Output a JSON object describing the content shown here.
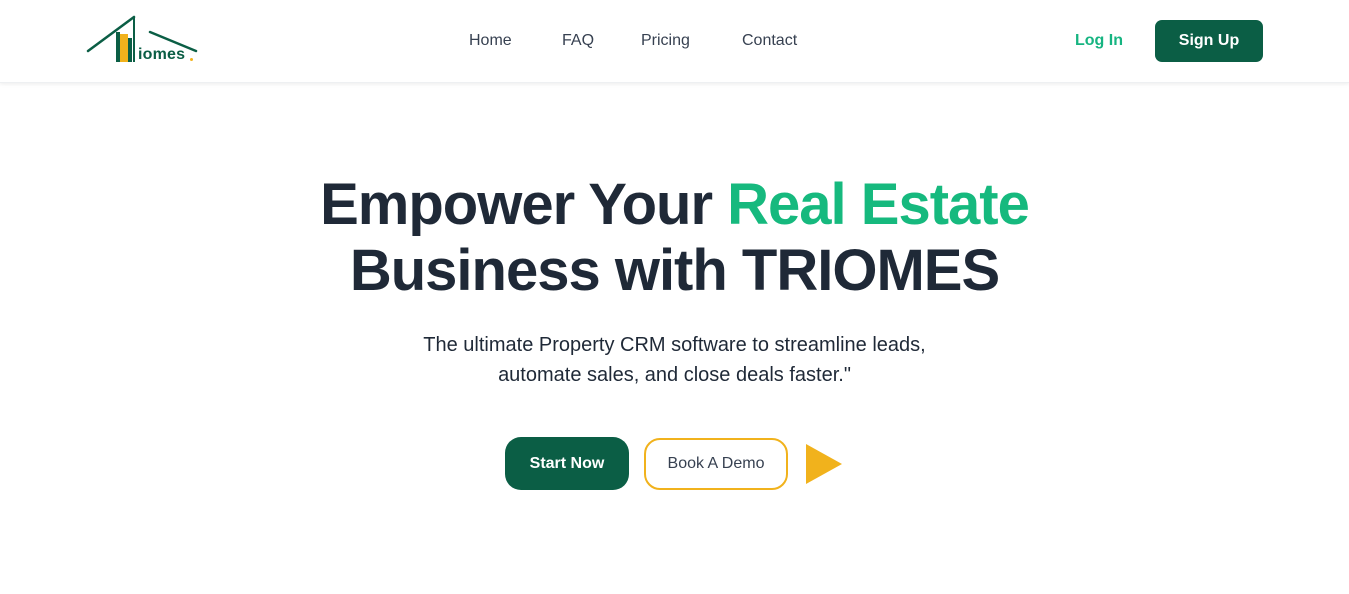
{
  "brand": {
    "logo_text": "iomes",
    "colors": {
      "primary": "#0b5e45",
      "accent_green": "#16b97e",
      "accent_yellow": "#f1b21c",
      "text": "#1f2937"
    }
  },
  "nav": {
    "items": [
      {
        "label": "Home"
      },
      {
        "label": "FAQ"
      },
      {
        "label": "Pricing"
      },
      {
        "label": "Contact"
      }
    ],
    "login_label": "Log In",
    "signup_label": "Sign Up"
  },
  "hero": {
    "title_part1": "Empower Your ",
    "title_accent": "Real Estate",
    "title_line2": "Business with TRIOMES",
    "subtitle_line1": "The ultimate Property CRM software to streamline leads,",
    "subtitle_line2": "automate sales, and close deals faster.\"",
    "primary_cta": "Start Now",
    "secondary_cta": "Book A Demo",
    "play_icon": "play-icon"
  }
}
